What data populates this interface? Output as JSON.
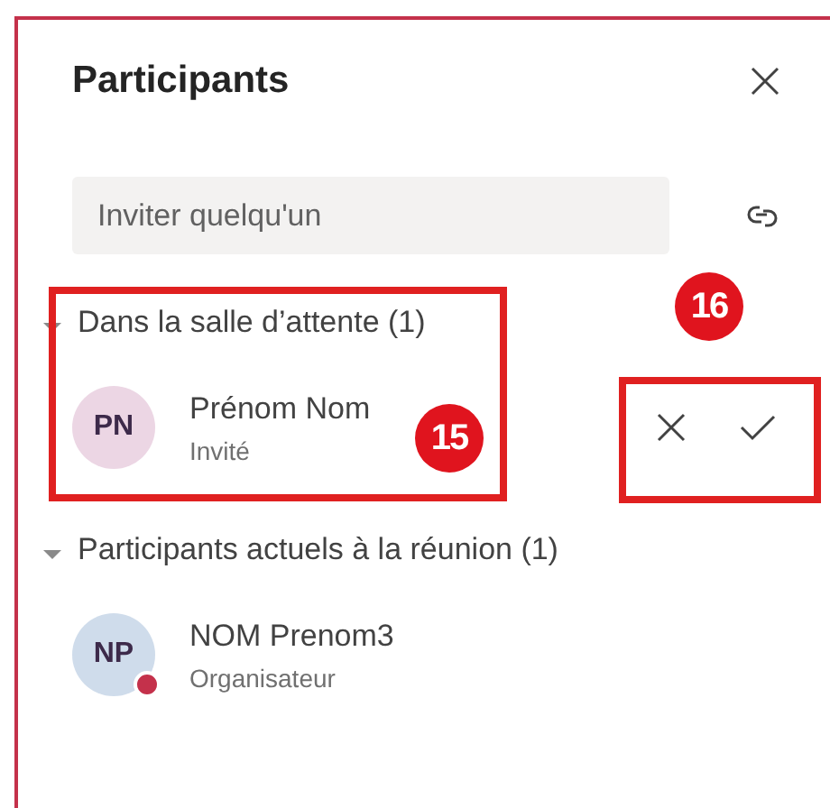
{
  "panel": {
    "title": "Participants",
    "invite": {
      "placeholder": "Inviter quelqu'un"
    },
    "sections": [
      {
        "header": "Dans la salle d’attente (1)",
        "expanded": true,
        "people": [
          {
            "initials": "PN",
            "name": "Prénom Nom",
            "role": "Invité",
            "color": "#ecd6e4",
            "kind": "waiting",
            "busy": false
          }
        ]
      },
      {
        "header": "Participants actuels à la réunion (1)",
        "expanded": true,
        "people": [
          {
            "initials": "NP",
            "name": "NOM Prenom3",
            "role": "Organisateur",
            "color": "#cfdceb",
            "kind": "present",
            "busy": true
          }
        ]
      }
    ]
  },
  "annotations": [
    {
      "number": "15"
    },
    {
      "number": "16"
    }
  ]
}
